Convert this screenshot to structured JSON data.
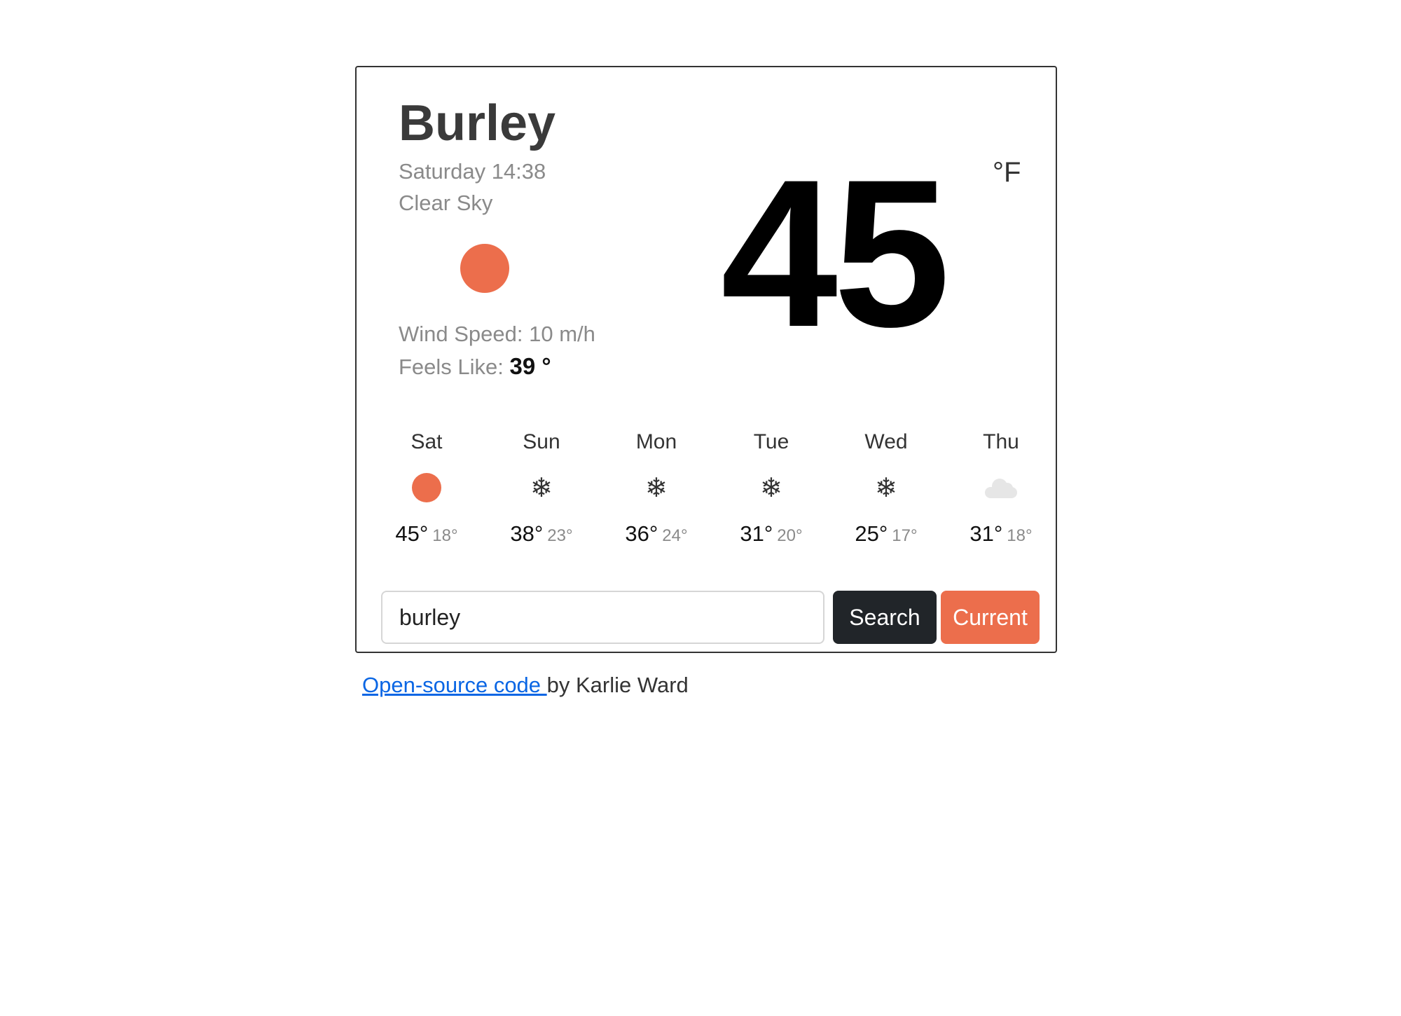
{
  "weather": {
    "city": "Burley",
    "date": "Saturday 14:38",
    "description": "Clear Sky",
    "icon": "sun-icon",
    "wind_label": "Wind Speed: ",
    "wind_value": "10 m/h",
    "feels_label": "Feels Like: ",
    "feels_value": "39 °",
    "temperature": "45",
    "unit": "°F"
  },
  "forecast": [
    {
      "day": "Sat",
      "icon": "sun",
      "max": "45°",
      "min": "18°"
    },
    {
      "day": "Sun",
      "icon": "snow",
      "max": "38°",
      "min": "23°"
    },
    {
      "day": "Mon",
      "icon": "snow",
      "max": "36°",
      "min": "24°"
    },
    {
      "day": "Tue",
      "icon": "snow",
      "max": "31°",
      "min": "20°"
    },
    {
      "day": "Wed",
      "icon": "snow",
      "max": "25°",
      "min": "17°"
    },
    {
      "day": "Thu",
      "icon": "cloud",
      "max": "31°",
      "min": "18°"
    }
  ],
  "search": {
    "value": "burley",
    "search_label": "Search",
    "current_label": "Current"
  },
  "footer": {
    "link_text": "Open-source code ",
    "suffix": "by Karlie Ward"
  },
  "colors": {
    "accent": "#ec6e4c",
    "dark_button": "#212529",
    "link": "#0a66e4"
  }
}
